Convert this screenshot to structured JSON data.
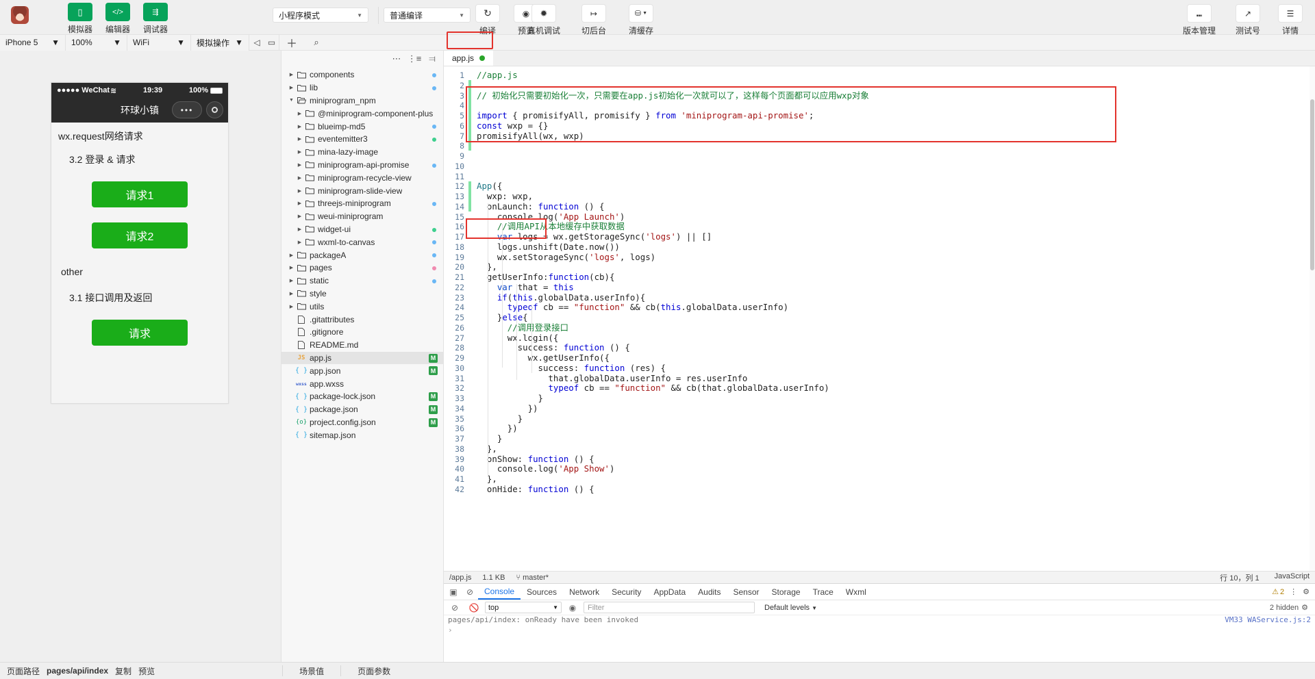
{
  "toolbar": {
    "buttons": [
      {
        "icon": "simulator-icon",
        "glyph": "▯",
        "label": "模拟器"
      },
      {
        "icon": "editor-icon",
        "glyph": "</>",
        "label": "编辑器"
      },
      {
        "icon": "debugger-icon",
        "glyph": "⇶",
        "label": "调试器"
      }
    ],
    "mode_select": "小程序模式",
    "compile_select": "普通编译",
    "actions": [
      {
        "icon": "refresh-icon",
        "glyph": "↻",
        "label": "编译"
      },
      {
        "icon": "eye-icon",
        "glyph": "◉",
        "label": "预览"
      }
    ],
    "actions2": [
      {
        "icon": "bug-icon",
        "glyph": "✹",
        "label": "真机调试"
      },
      {
        "icon": "background-icon",
        "glyph": "↦",
        "label": "切后台"
      },
      {
        "icon": "clear-cache-icon",
        "glyph": "⛁",
        "label": "清缓存",
        "caret": true
      }
    ],
    "right_actions": [
      {
        "icon": "version-icon",
        "glyph": "⑉",
        "label": "版本管理"
      },
      {
        "icon": "test-account-icon",
        "glyph": "↗",
        "label": "测试号"
      },
      {
        "icon": "details-icon",
        "glyph": "☰",
        "label": "详情"
      }
    ]
  },
  "bar2": {
    "device": "iPhone 5",
    "zoom": "100%",
    "network": "WiFi",
    "mock": "模拟操作",
    "icons": [
      "volume-icon",
      "screen-icon"
    ]
  },
  "simulator": {
    "status_carrier": "●●●●● WeChat",
    "wifi_glyph": "≋",
    "time": "19:39",
    "battery": "100%",
    "nav_title": "环球小镇",
    "capsule_glyph": "•••",
    "page_title": "wx.request网络请求",
    "section1": "3.2 登录 & 请求",
    "button1": "请求1",
    "button2": "请求2",
    "other_label": "other",
    "section2": "3.1 接口调用及返回",
    "button3": "请求"
  },
  "explorer": {
    "toolbar_icons": [
      "add-icon",
      "search-icon",
      "more-icon",
      "sort-icon",
      "collapse-icon"
    ],
    "tree": [
      {
        "name": "components",
        "type": "folder",
        "indent": 0,
        "open": false,
        "dot": "#6ab7f5"
      },
      {
        "name": "lib",
        "type": "folder",
        "indent": 0,
        "open": false,
        "dot": "#6ab7f5"
      },
      {
        "name": "miniprogram_npm",
        "type": "folder",
        "indent": 0,
        "open": true,
        "dot": ""
      },
      {
        "name": "@miniprogram-component-plus",
        "type": "folder",
        "indent": 1,
        "open": false,
        "dot": ""
      },
      {
        "name": "blueimp-md5",
        "type": "folder",
        "indent": 1,
        "open": false,
        "dot": "#6ab7f5"
      },
      {
        "name": "eventemitter3",
        "type": "folder",
        "indent": 1,
        "open": false,
        "dot": "#3ecf8e"
      },
      {
        "name": "mina-lazy-image",
        "type": "folder",
        "indent": 1,
        "open": false,
        "dot": ""
      },
      {
        "name": "miniprogram-api-promise",
        "type": "folder",
        "indent": 1,
        "open": false,
        "dot": "#6ab7f5"
      },
      {
        "name": "miniprogram-recycle-view",
        "type": "folder",
        "indent": 1,
        "open": false,
        "dot": ""
      },
      {
        "name": "miniprogram-slide-view",
        "type": "folder",
        "indent": 1,
        "open": false,
        "dot": ""
      },
      {
        "name": "threejs-miniprogram",
        "type": "folder",
        "indent": 1,
        "open": false,
        "dot": "#6ab7f5"
      },
      {
        "name": "weui-miniprogram",
        "type": "folder",
        "indent": 1,
        "open": false,
        "dot": ""
      },
      {
        "name": "widget-ui",
        "type": "folder",
        "indent": 1,
        "open": false,
        "dot": "#3ecf8e"
      },
      {
        "name": "wxml-to-canvas",
        "type": "folder",
        "indent": 1,
        "open": false,
        "dot": "#6ab7f5"
      },
      {
        "name": "packageA",
        "type": "folder",
        "indent": 0,
        "open": false,
        "dot": "#6ab7f5"
      },
      {
        "name": "pages",
        "type": "folder",
        "indent": 0,
        "open": false,
        "dot": "#f08bb0"
      },
      {
        "name": "static",
        "type": "folder",
        "indent": 0,
        "open": false,
        "dot": "#6ab7f5"
      },
      {
        "name": "style",
        "type": "folder",
        "indent": 0,
        "open": false,
        "dot": ""
      },
      {
        "name": "utils",
        "type": "folder",
        "indent": 0,
        "open": false,
        "dot": ""
      },
      {
        "name": ".gitattributes",
        "type": "file",
        "indent": 0,
        "icon": "txt",
        "dot": ""
      },
      {
        "name": ".gitignore",
        "type": "file",
        "indent": 0,
        "icon": "txt",
        "dot": ""
      },
      {
        "name": "README.md",
        "type": "file",
        "indent": 0,
        "icon": "txt",
        "dot": ""
      },
      {
        "name": "app.js",
        "type": "file",
        "indent": 0,
        "icon": "js",
        "selected": true,
        "badge": "M"
      },
      {
        "name": "app.json",
        "type": "file",
        "indent": 0,
        "icon": "json",
        "badge": "M"
      },
      {
        "name": "app.wxss",
        "type": "file",
        "indent": 0,
        "icon": "wxss",
        "badge": ""
      },
      {
        "name": "package-lock.json",
        "type": "file",
        "indent": 0,
        "icon": "json",
        "badge": "M"
      },
      {
        "name": "package.json",
        "type": "file",
        "indent": 0,
        "icon": "json",
        "badge": "M"
      },
      {
        "name": "project.config.json",
        "type": "file",
        "indent": 0,
        "icon": "cfg",
        "badge": "M"
      },
      {
        "name": "sitemap.json",
        "type": "file",
        "indent": 0,
        "icon": "json",
        "badge": ""
      }
    ]
  },
  "editor": {
    "tab_name": "app.js",
    "tab_modified": true,
    "first_line": 1,
    "lines": [
      {
        "n": 1,
        "html": "<span class='cmt'>//app.js</span>"
      },
      {
        "n": 2,
        "html": ""
      },
      {
        "n": 3,
        "html": "<span class='cmt'>// 初始化只需要初始化一次，只需要在app.js初始化一次就可以了，这样每个页面都可以应用wxp对象</span>"
      },
      {
        "n": 4,
        "html": ""
      },
      {
        "n": 5,
        "html": "<span class='kw'>import</span> { promisifyAll, promisify } <span class='kw'>from</span> <span class='str'>'miniprogram-api-promise'</span>;"
      },
      {
        "n": 6,
        "html": "<span class='kw'>const</span> wxp = {}"
      },
      {
        "n": 7,
        "html": "promisifyAll(wx, wxp)"
      },
      {
        "n": 8,
        "html": ""
      },
      {
        "n": 9,
        "html": ""
      },
      {
        "n": 10,
        "html": ""
      },
      {
        "n": 11,
        "html": ""
      },
      {
        "n": 12,
        "html": "<span class='ty'>App</span>({"
      },
      {
        "n": 13,
        "html": "  wxp: wxp,"
      },
      {
        "n": 14,
        "html": "  onLaunch: <span class='kw'>function</span> () {"
      },
      {
        "n": 15,
        "html": "    console.log(<span class='str'>'App Launch'</span>)"
      },
      {
        "n": 16,
        "html": "    <span class='cmt'>//调用API从本地缓存中获取数据</span>"
      },
      {
        "n": 17,
        "html": "    <span class='kw2'>var</span> logs = wx.getStorageSync(<span class='str'>'logs'</span>) || []"
      },
      {
        "n": 18,
        "html": "    logs.unshift(Date.now())"
      },
      {
        "n": 19,
        "html": "    wx.setStorageSync(<span class='str'>'logs'</span>, logs)"
      },
      {
        "n": 20,
        "html": "  },"
      },
      {
        "n": 21,
        "html": "  getUserInfo:<span class='kw'>function</span>(cb){"
      },
      {
        "n": 22,
        "html": "    <span class='kw2'>var</span> that = <span class='kw'>this</span>"
      },
      {
        "n": 23,
        "html": "    <span class='kw'>if</span>(<span class='kw'>this</span>.globalData.userInfo){"
      },
      {
        "n": 24,
        "html": "      <span class='kw'>typeof</span> cb == <span class='str'>\"function\"</span> && cb(<span class='kw'>this</span>.globalData.userInfo)"
      },
      {
        "n": 25,
        "html": "    }<span class='kw'>else</span>{"
      },
      {
        "n": 26,
        "html": "      <span class='cmt'>//调用登录接口</span>"
      },
      {
        "n": 27,
        "html": "      wx.login({"
      },
      {
        "n": 28,
        "html": "        success: <span class='kw'>function</span> () {"
      },
      {
        "n": 29,
        "html": "          wx.getUserInfo({"
      },
      {
        "n": 30,
        "html": "            success: <span class='kw'>function</span> (res) {"
      },
      {
        "n": 31,
        "html": "              that.globalData.userInfo = res.userInfo"
      },
      {
        "n": 32,
        "html": "              <span class='kw'>typeof</span> cb == <span class='str'>\"function\"</span> && cb(that.globalData.userInfo)"
      },
      {
        "n": 33,
        "html": "            }"
      },
      {
        "n": 34,
        "html": "          })"
      },
      {
        "n": 35,
        "html": "        }"
      },
      {
        "n": 36,
        "html": "      })"
      },
      {
        "n": 37,
        "html": "    }"
      },
      {
        "n": 38,
        "html": "  },"
      },
      {
        "n": 39,
        "html": "  onShow: <span class='kw'>function</span> () {"
      },
      {
        "n": 40,
        "html": "    console.log(<span class='str'>'App Show'</span>)"
      },
      {
        "n": 41,
        "html": "  },"
      },
      {
        "n": 42,
        "html": "  onHide: <span class='kw'>function</span> () {"
      }
    ],
    "status": {
      "file": "/app.js",
      "size": "1.1 KB",
      "branch_icon": "branch-icon",
      "branch": "master*",
      "cursor": "行 10，列 1",
      "language": "JavaScript"
    }
  },
  "devtools": {
    "tabs": [
      "Console",
      "Sources",
      "Network",
      "Security",
      "AppData",
      "Audits",
      "Sensor",
      "Storage",
      "Trace",
      "Wxml"
    ],
    "active_tab": "Console",
    "warn_count": "2",
    "more_glyph": "⋮",
    "settings_glyph": "⚙",
    "context": "top",
    "filter_placeholder": "Filter",
    "levels": "Default levels",
    "hidden_text": "2 hidden",
    "log_line": "pages/api/index: onReady have been invoked",
    "log_source": "VM33 WAService.js:2",
    "prompt": "›"
  },
  "footer": {
    "label_path": "页面路径",
    "path": "pages/api/index",
    "copy": "复制",
    "preview": "预览",
    "scene": "场景值",
    "params": "页面参数"
  }
}
